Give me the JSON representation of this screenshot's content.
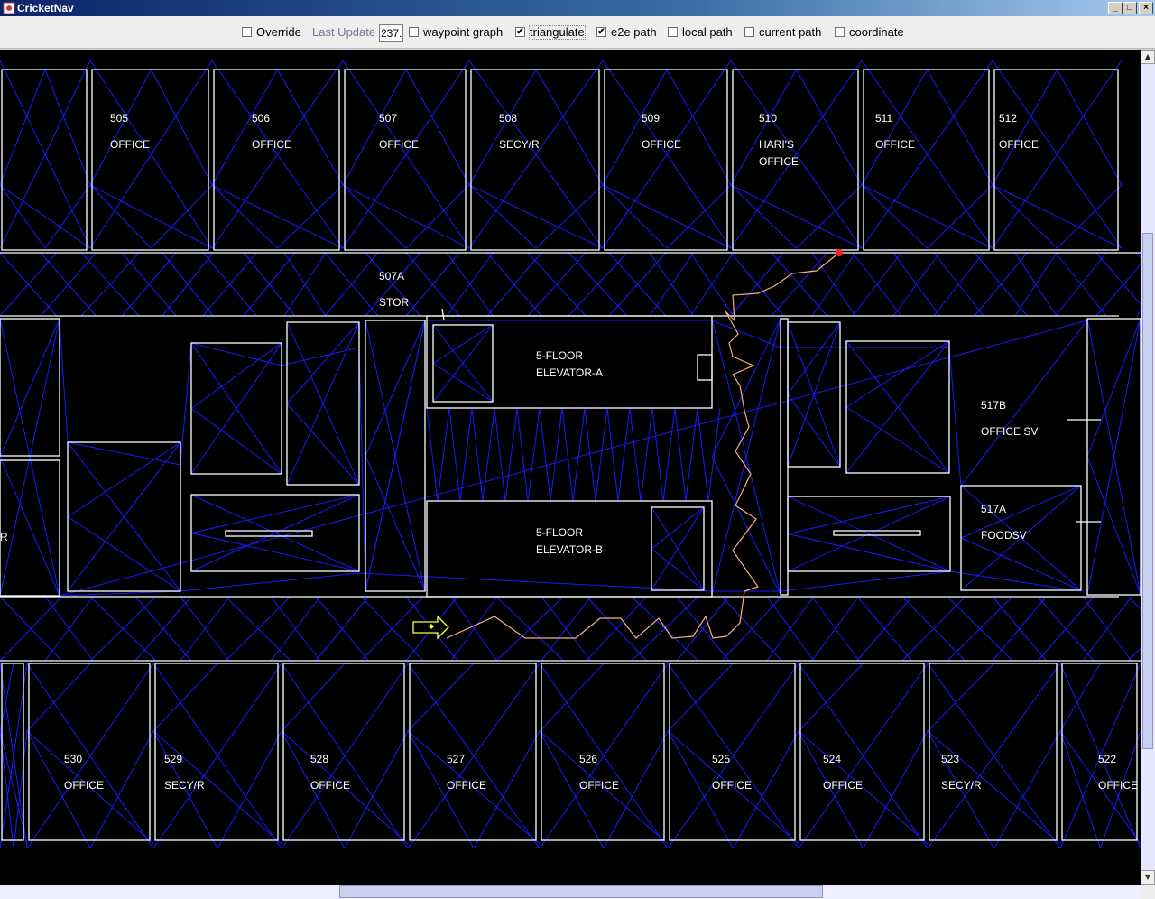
{
  "window": {
    "title": "CricketNav",
    "minimize": "_",
    "maximize": "□",
    "close": "×"
  },
  "toolbar": {
    "override_label": "Override",
    "last_update_label": "Last Update",
    "last_update_value": "237.",
    "waypoint_graph_label": "waypoint graph",
    "triangulate_label": "triangulate",
    "e2e_path_label": "e2e path",
    "local_path_label": "local path",
    "current_path_label": "current path",
    "coordinate_label": "coordinate",
    "override_checked": false,
    "waypoint_graph_checked": false,
    "triangulate_checked": true,
    "e2e_path_checked": true,
    "local_path_checked": false,
    "current_path_checked": false,
    "coordinate_checked": false,
    "check_mark": "✔"
  },
  "rooms_top": [
    {
      "number": "505",
      "name": "OFFICE"
    },
    {
      "number": "506",
      "name": "OFFICE"
    },
    {
      "number": "507",
      "name": "OFFICE"
    },
    {
      "number": "508",
      "name": "SECY/R"
    },
    {
      "number": "509",
      "name": "OFFICE"
    },
    {
      "number": "510",
      "name": "HARI'S",
      "name2": "OFFICE"
    },
    {
      "number": "511",
      "name": "OFFICE"
    },
    {
      "number": "512",
      "name": "OFFICE"
    }
  ],
  "rooms_bottom": [
    {
      "number": "530",
      "name": "OFFICE"
    },
    {
      "number": "529",
      "name": "SECY/R"
    },
    {
      "number": "528",
      "name": "OFFICE"
    },
    {
      "number": "527",
      "name": "OFFICE"
    },
    {
      "number": "526",
      "name": "OFFICE"
    },
    {
      "number": "525",
      "name": "OFFICE"
    },
    {
      "number": "524",
      "name": "OFFICE"
    },
    {
      "number": "523",
      "name": "SECY/R"
    },
    {
      "number": "522",
      "name": "OFFICE"
    }
  ],
  "rooms_mid": {
    "storage": {
      "number": "507A",
      "name": "STOR"
    },
    "elevator_a": {
      "line1": "5-FLOOR",
      "line2": "ELEVATOR-A"
    },
    "elevator_b": {
      "line1": "5-FLOOR",
      "line2": "ELEVATOR-B"
    },
    "r517b": {
      "number": "517B",
      "name": "OFFICE SV"
    },
    "r517a": {
      "number": "517A",
      "name": "FOODSV"
    },
    "left_edge_r": "R"
  },
  "colors": {
    "background": "#000000",
    "walls": "#ffffff",
    "triangulation": "#1a1aff",
    "path": "#f0b080",
    "marker": "#ff2020",
    "pointer": "#ffff33"
  }
}
